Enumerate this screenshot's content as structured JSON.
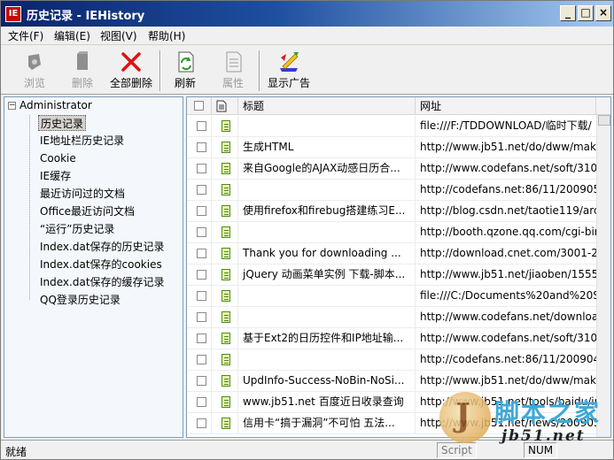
{
  "window": {
    "title": "历史记录 - IEHistory",
    "icon_text": "IE",
    "controls": [
      "_",
      "□",
      "×"
    ]
  },
  "menu": [
    "文件(F)",
    "编辑(E)",
    "视图(V)",
    "帮助(H)"
  ],
  "toolbar": {
    "browse": "浏览",
    "delete": "删除",
    "delete_all": "全部删除",
    "refresh": "刷新",
    "properties": "属性",
    "show_ads": "显示广告"
  },
  "tree": {
    "root": "Administrator",
    "items": [
      "历史记录",
      "IE地址栏历史记录",
      "Cookie",
      "IE缓存",
      "最近访问过的文档",
      "Office最近访问文档",
      "“运行”历史记录",
      "Index.dat保存的历史记录",
      "Index.dat保存的cookies",
      "Index.dat保存的缓存记录",
      "QQ登录历史记录"
    ]
  },
  "list": {
    "columns": [
      "标题",
      "网址"
    ],
    "rows": [
      {
        "title": "",
        "url": "file:///F:/TDDOWNLOAD/临时下载/"
      },
      {
        "title": "生成HTML",
        "url": "http://www.jb51.net/do/dww/make"
      },
      {
        "title": "来自Google的AJAX动感日历合...",
        "url": "http://www.codefans.net/soft/3105"
      },
      {
        "title": "",
        "url": "http://codefans.net:86/11/200905/"
      },
      {
        "title": "使用firefox和firebug搭建练习E...",
        "url": "http://blog.csdn.net/taotie119/arc"
      },
      {
        "title": "",
        "url": "http://booth.qzone.qq.com/cgi-bin"
      },
      {
        "title": "Thank you for downloading ...",
        "url": "http://download.cnet.com/3001-23"
      },
      {
        "title": "jQuery 动画菜单实例 下载-脚本...",
        "url": "http://www.jb51.net/jiaoben/15555"
      },
      {
        "title": "",
        "url": "file:///C:/Documents%20and%20Se"
      },
      {
        "title": "",
        "url": "http://www.codefans.net/download"
      },
      {
        "title": "基于Ext2的日历控件和IP地址输...",
        "url": "http://www.codefans.net/soft/3103"
      },
      {
        "title": "",
        "url": "http://codefans.net:86/11/200904/"
      },
      {
        "title": "UpdInfo-Success-NoBin-NoSi...",
        "url": "http://www.jb51.net/do/dww/make"
      },
      {
        "title": "www.jb51.net 百度近日收录查询",
        "url": "http://www.jb51.net/tools/baidu/in"
      },
      {
        "title": "信用卡“搞于漏洞”不可怕 五法...",
        "url": "http://www.jb51.net/news/200905"
      }
    ]
  },
  "status": {
    "text": "就绪",
    "panel_script": "Script",
    "panel_num": "NUM"
  },
  "watermark": {
    "letter": "J",
    "site_cn": "脚本之家",
    "site_url": "jb51.net"
  }
}
